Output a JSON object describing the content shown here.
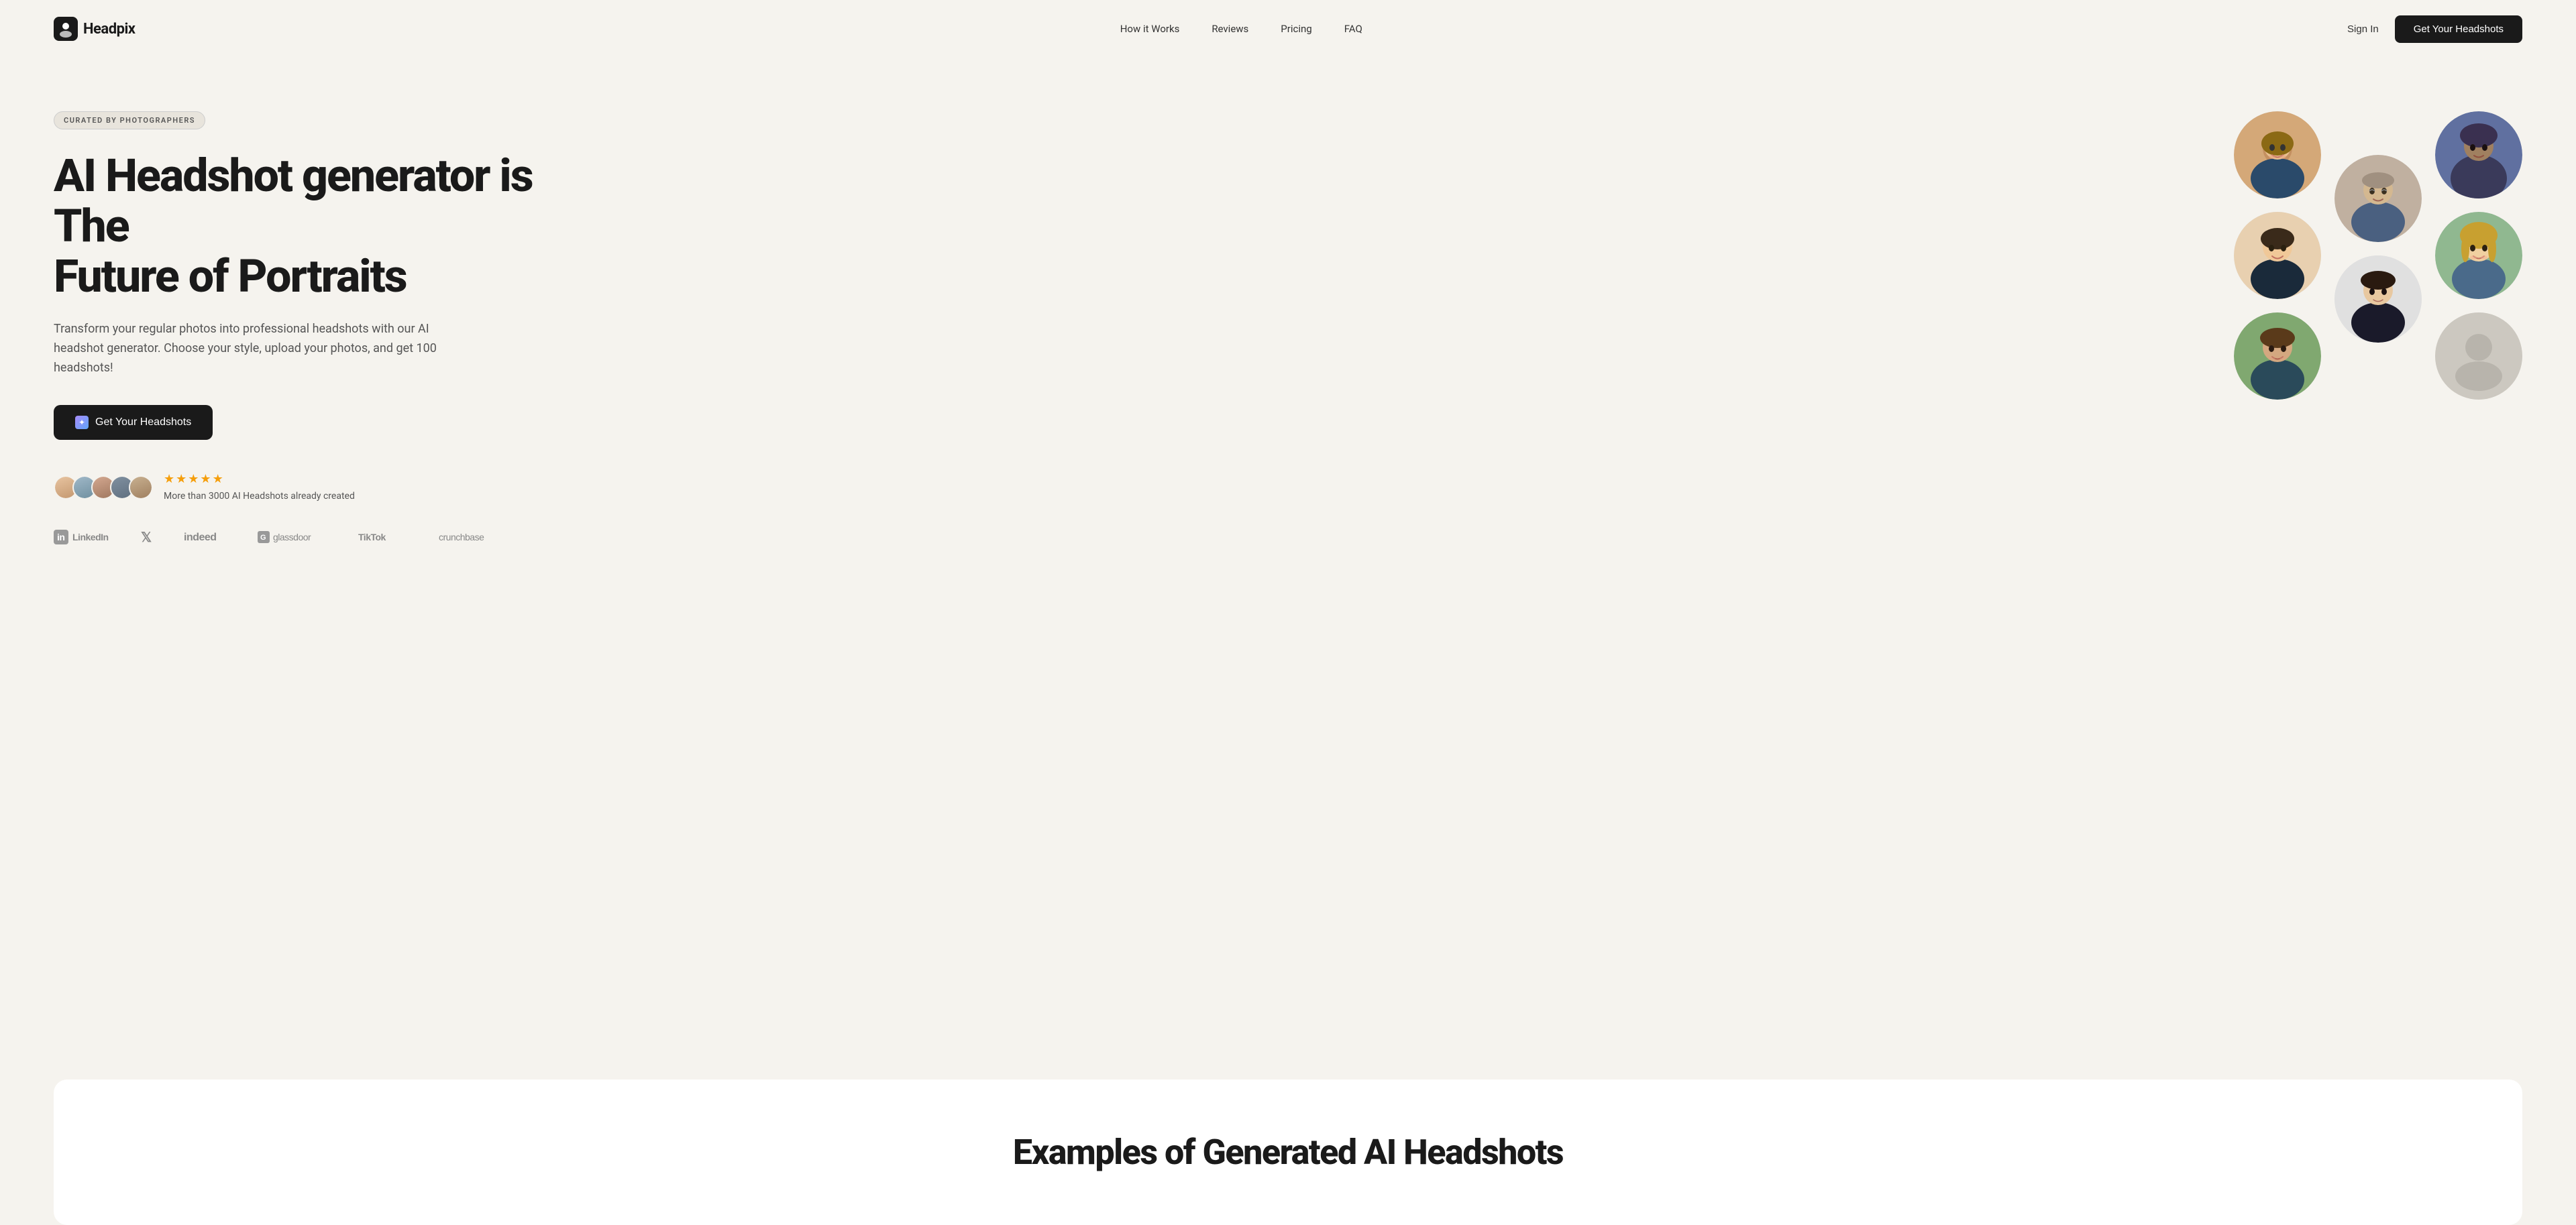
{
  "brand": {
    "name": "Headpix",
    "logo_alt": "Headpix logo"
  },
  "navbar": {
    "logo": "Headpix",
    "links": [
      {
        "id": "how-it-works",
        "label": "How it Works"
      },
      {
        "id": "reviews",
        "label": "Reviews"
      },
      {
        "id": "pricing",
        "label": "Pricing"
      },
      {
        "id": "faq",
        "label": "FAQ"
      }
    ],
    "sign_in": "Sign In",
    "get_headshots": "Get Your Headshots"
  },
  "hero": {
    "badge": "CURATED BY PHOTOGRAPHERS",
    "title_line1": "AI Headshot generator is The",
    "title_line2": "Future of Portraits",
    "subtitle": "Transform your regular photos into professional headshots with our AI headshot generator. Choose your style, upload your photos, and get 100 headshots!",
    "cta_label": "Get Your Headshots",
    "social_proof": {
      "count_text": "More than 3000 AI Headshots already created",
      "stars": 5
    },
    "brands": [
      {
        "id": "linkedin",
        "label": "LinkedIn"
      },
      {
        "id": "x",
        "label": "𝕏"
      },
      {
        "id": "indeed",
        "label": "indeed"
      },
      {
        "id": "glassdoor",
        "label": "glassdoor"
      },
      {
        "id": "tiktok",
        "label": "TikTok"
      },
      {
        "id": "crunchbase",
        "label": "crunchbase"
      }
    ]
  },
  "headshots": {
    "grid": [
      {
        "id": 1,
        "col": 1,
        "description": "woman smiling professional"
      },
      {
        "id": 2,
        "col": 1,
        "description": "woman business formal"
      },
      {
        "id": 3,
        "col": 1,
        "description": "woman outdoors"
      },
      {
        "id": 4,
        "col": 2,
        "description": "man business casual"
      },
      {
        "id": 5,
        "col": 2,
        "description": "woman neutral"
      },
      {
        "id": 6,
        "col": 3,
        "description": "man older professional"
      },
      {
        "id": 7,
        "col": 3,
        "description": "woman blonde"
      },
      {
        "id": 8,
        "col": 3,
        "description": "empty placeholder"
      }
    ]
  },
  "examples_section": {
    "title": "Examples of Generated AI Headshots"
  }
}
